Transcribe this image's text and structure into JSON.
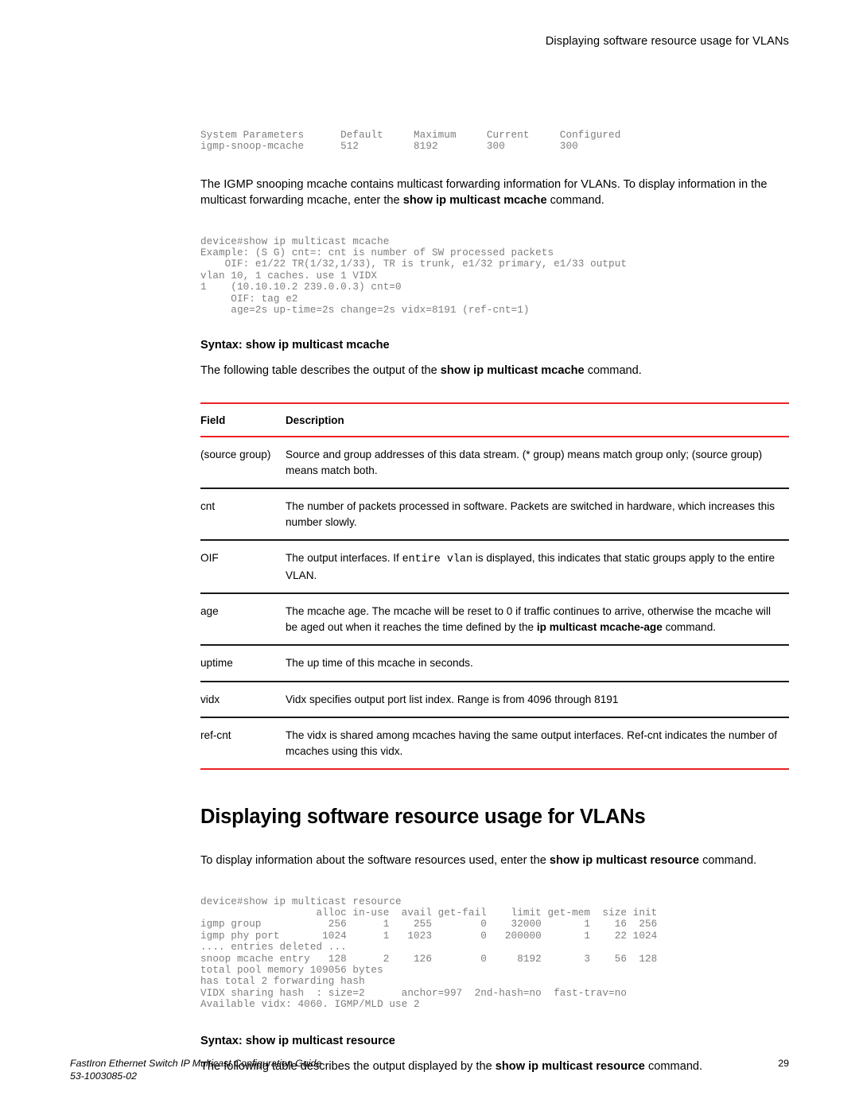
{
  "header": {
    "running_title": "Displaying software resource usage for VLANs"
  },
  "code_block_1": "System Parameters      Default     Maximum     Current     Configured\nigmp-snoop-mcache      512         8192        300         300",
  "paragraph_1": {
    "before": "The IGMP snooping mcache contains multicast forwarding information for VLANs. To display information in the multicast forwarding mcache, enter the ",
    "bold": "show ip multicast mcache",
    "after": " command."
  },
  "code_block_2": "device#show ip multicast mcache\nExample: (S G) cnt=: cnt is number of SW processed packets\n    OIF: e1/22 TR(1/32,1/33), TR is trunk, e1/32 primary, e1/33 output\nvlan 10, 1 caches. use 1 VIDX\n1    (10.10.10.2 239.0.0.3) cnt=0\n     OIF: tag e2\n     age=2s up-time=2s change=2s vidx=8191 (ref-cnt=1)",
  "syntax_1": "Syntax: show ip multicast mcache",
  "paragraph_2": {
    "before": "The following table describes the output of the ",
    "bold": "show ip multicast mcache",
    "after": " command."
  },
  "table_1": {
    "columns": [
      "Field",
      "Description"
    ],
    "rows": [
      {
        "field": "(source group)",
        "desc_parts": [
          {
            "text": "Source and group addresses of this data stream. (* group) means match group only; (source group) means match both.",
            "style": "normal"
          }
        ]
      },
      {
        "field": "cnt",
        "desc_parts": [
          {
            "text": "The number of packets processed in software. Packets are switched in hardware, which increases this number slowly.",
            "style": "normal"
          }
        ]
      },
      {
        "field": "OIF",
        "desc_parts": [
          {
            "text": "The output interfaces. If ",
            "style": "normal"
          },
          {
            "text": "entire vlan",
            "style": "mono"
          },
          {
            "text": " is displayed, this indicates that static groups apply to the entire VLAN.",
            "style": "normal"
          }
        ]
      },
      {
        "field": "age",
        "desc_parts": [
          {
            "text": "The mcache age. The mcache will be reset to 0 if traffic continues to arrive, otherwise the mcache will be aged out when it reaches the time defined by the ",
            "style": "normal"
          },
          {
            "text": "ip multicast mcache-age",
            "style": "bold"
          },
          {
            "text": " command.",
            "style": "normal"
          }
        ]
      },
      {
        "field": "uptime",
        "desc_parts": [
          {
            "text": "The up time of this mcache in seconds.",
            "style": "normal"
          }
        ]
      },
      {
        "field": "vidx",
        "desc_parts": [
          {
            "text": "Vidx specifies output port list index. Range is from 4096 through 8191",
            "style": "normal"
          }
        ]
      },
      {
        "field": "ref-cnt",
        "desc_parts": [
          {
            "text": "The vidx is shared among mcaches having the same output interfaces. Ref-cnt indicates the number of mcaches using this vidx.",
            "style": "normal"
          }
        ]
      }
    ]
  },
  "section_heading": "Displaying software resource usage for VLANs",
  "paragraph_3": {
    "before": "To display information about the software resources used, enter the ",
    "bold": "show ip multicast resource",
    "after": " command."
  },
  "code_block_3": "device#show ip multicast resource\n                   alloc in-use  avail get-fail    limit get-mem  size init\nigmp group           256      1    255        0    32000       1    16  256\nigmp phy port       1024      1   1023        0   200000       1    22 1024\n.... entries deleted ...\nsnoop mcache entry   128      2    126        0     8192       3    56  128\ntotal pool memory 109056 bytes\nhas total 2 forwarding hash\nVIDX sharing hash  : size=2      anchor=997  2nd-hash=no  fast-trav=no\nAvailable vidx: 4060. IGMP/MLD use 2",
  "syntax_2": "Syntax: show ip multicast resource",
  "paragraph_4": {
    "before": "The following table describes the output displayed by the ",
    "bold": "show ip multicast resource",
    "after": " command."
  },
  "footer": {
    "title": "FastIron Ethernet Switch IP Multicast Configuration Guide",
    "doc_id": "53-1003085-02",
    "page_number": "29"
  },
  "colors": {
    "accent_red": "#ee2222",
    "rule_dark": "#1a1a1a",
    "code_gray": "#7d7d7d"
  }
}
